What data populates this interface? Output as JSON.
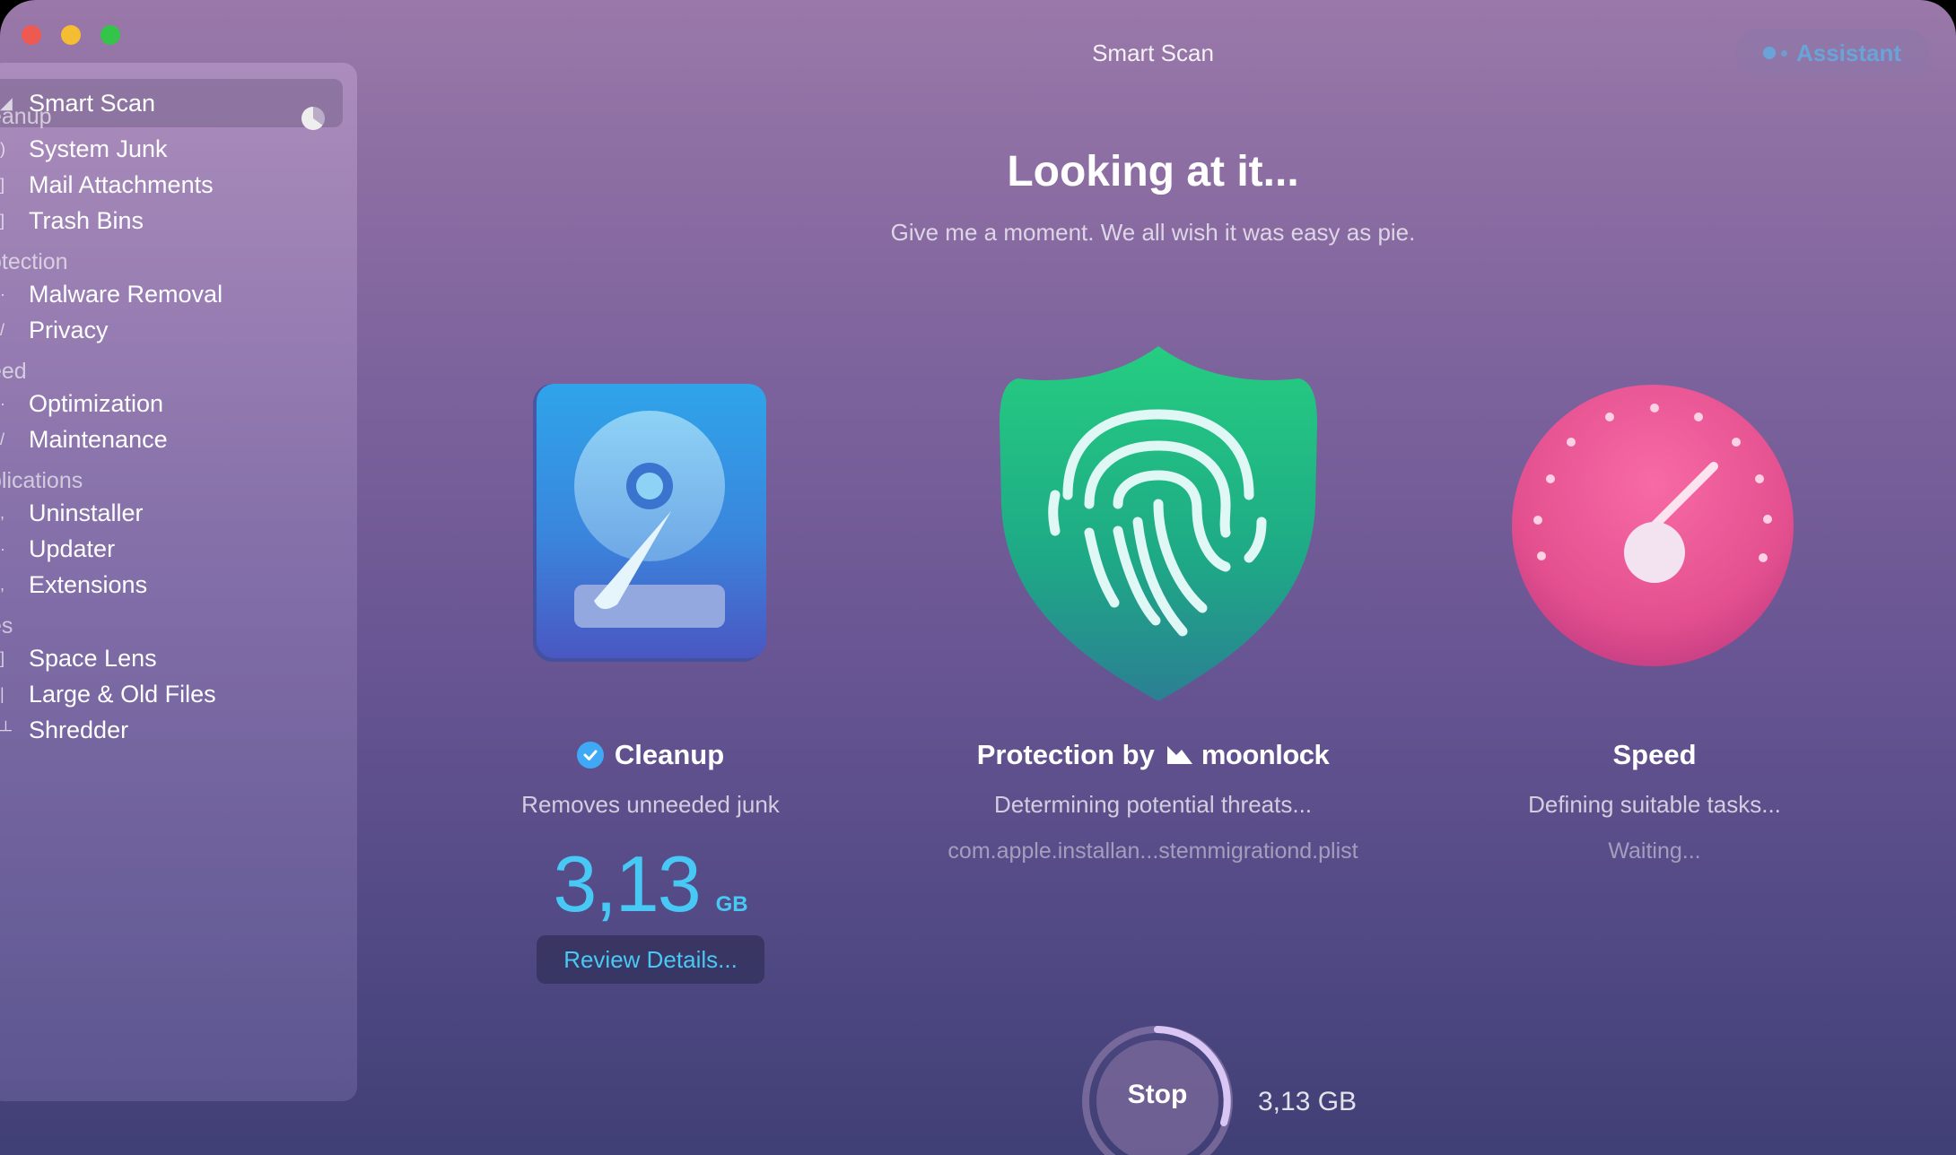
{
  "window": {
    "title": "Smart Scan"
  },
  "assistant": {
    "label": "Assistant"
  },
  "sidebar": {
    "active": {
      "label": "Smart Scan"
    },
    "sections": [
      {
        "label": "eanup",
        "items": [
          {
            "label": "System Junk"
          },
          {
            "label": "Mail Attachments"
          },
          {
            "label": "Trash Bins"
          }
        ]
      },
      {
        "label": "otection",
        "items": [
          {
            "label": "Malware Removal"
          },
          {
            "label": "Privacy"
          }
        ]
      },
      {
        "label": "eed",
        "items": [
          {
            "label": "Optimization"
          },
          {
            "label": "Maintenance"
          }
        ]
      },
      {
        "label": "plications",
        "items": [
          {
            "label": "Uninstaller"
          },
          {
            "label": "Updater"
          },
          {
            "label": "Extensions"
          }
        ]
      },
      {
        "label": "es",
        "items": [
          {
            "label": "Space Lens"
          },
          {
            "label": "Large & Old Files"
          },
          {
            "label": "Shredder"
          }
        ]
      }
    ]
  },
  "main": {
    "headline": "Looking at it...",
    "subheadline": "Give me a moment. We all wish it was easy as pie."
  },
  "modules": {
    "cleanup": {
      "title": "Cleanup",
      "description": "Removes unneeded junk",
      "size_value": "3,13",
      "size_unit": "GB",
      "review_label": "Review Details..."
    },
    "protection": {
      "title": "Protection by",
      "brand": "moonlock",
      "status": "Determining potential threats...",
      "current_file": "com.apple.installan...stemmigrationd.plist"
    },
    "speed": {
      "title": "Speed",
      "status": "Defining suitable tasks...",
      "state": "Waiting..."
    }
  },
  "footer": {
    "stop_label": "Stop",
    "total_size": "3,13 GB"
  },
  "colors": {
    "accent": "#47c8f5",
    "cleanup_icon": "#3d78d8",
    "protection_icon": "#22c78a",
    "speed_icon": "#e9558f"
  },
  "icons": {
    "cleanup": "hard-drive-icon",
    "protection": "fingerprint-shield-icon",
    "speed": "speedometer-icon"
  }
}
